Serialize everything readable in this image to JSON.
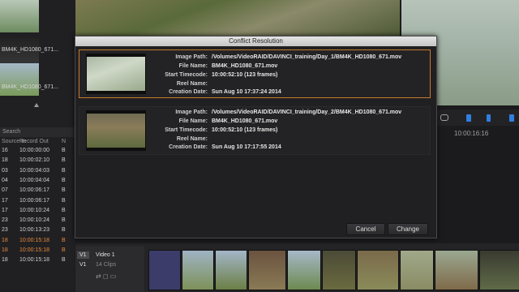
{
  "left_panel": {
    "thumb_labels": [
      "BM4K_HD1080_671...",
      "BM4K_HD1080_671..."
    ],
    "search_placeholder": "Search",
    "columns": [
      "Source In",
      "Record Out",
      "N"
    ],
    "rows": [
      {
        "a": "16",
        "b": "10:00:00:00",
        "c": "B",
        "hl": false
      },
      {
        "a": "18",
        "b": "10:00:02:10",
        "c": "B",
        "hl": false
      },
      {
        "a": "03",
        "b": "10:00:04:03",
        "c": "B",
        "hl": false
      },
      {
        "a": "04",
        "b": "10:00:04:04",
        "c": "B",
        "hl": false
      },
      {
        "a": "07",
        "b": "10:00:06:17",
        "c": "B",
        "hl": false
      },
      {
        "a": "17",
        "b": "10:00:06:17",
        "c": "B",
        "hl": false
      },
      {
        "a": "17",
        "b": "10:00:10:24",
        "c": "B",
        "hl": false
      },
      {
        "a": "23",
        "b": "10:00:10:24",
        "c": "B",
        "hl": false
      },
      {
        "a": "23",
        "b": "10:00:13:23",
        "c": "B",
        "hl": false
      },
      {
        "a": "18",
        "b": "10:00:15:18",
        "c": "B",
        "hl": true
      },
      {
        "a": "18",
        "b": "10:00:15:18",
        "c": "B",
        "hl": true
      },
      {
        "a": "18",
        "b": "10:00:15:18",
        "c": "B",
        "hl": false
      }
    ]
  },
  "timeline": {
    "timecode": "10:00:16:16",
    "track_label": "V1",
    "track_name": "Video 1",
    "clip_count": "14 Clips"
  },
  "dialog": {
    "title": "Conflict Resolution",
    "labels": {
      "image_path": "Image Path:",
      "file_name": "File Name:",
      "start_tc": "Start Timecode:",
      "reel": "Reel Name:",
      "created": "Creation Date:"
    },
    "entries": [
      {
        "image_path": "/Volumes/VideoRAID/DAVINCI_training/Day_1/BM4K_HD1080_671.mov",
        "file_name": "BM4K_HD1080_671.mov",
        "start_tc": "10:00:52:10 (123 frames)",
        "reel": "",
        "created": "Sun Aug 10 17:37:24 2014"
      },
      {
        "image_path": "/Volumes/VideoRAID/DAVINCI_training/Day_2/BM4K_HD1080_671.mov",
        "file_name": "BM4K_HD1080_671.mov",
        "start_tc": "10:00:52:10 (123 frames)",
        "reel": "",
        "created": "Sun Aug 10 17:17:55 2014"
      }
    ],
    "cancel_label": "Cancel",
    "change_label": "Change"
  },
  "colors": {
    "selection": "#c7782d",
    "highlight_row": "#e8893a",
    "accent_blue": "#2f7fe0"
  }
}
